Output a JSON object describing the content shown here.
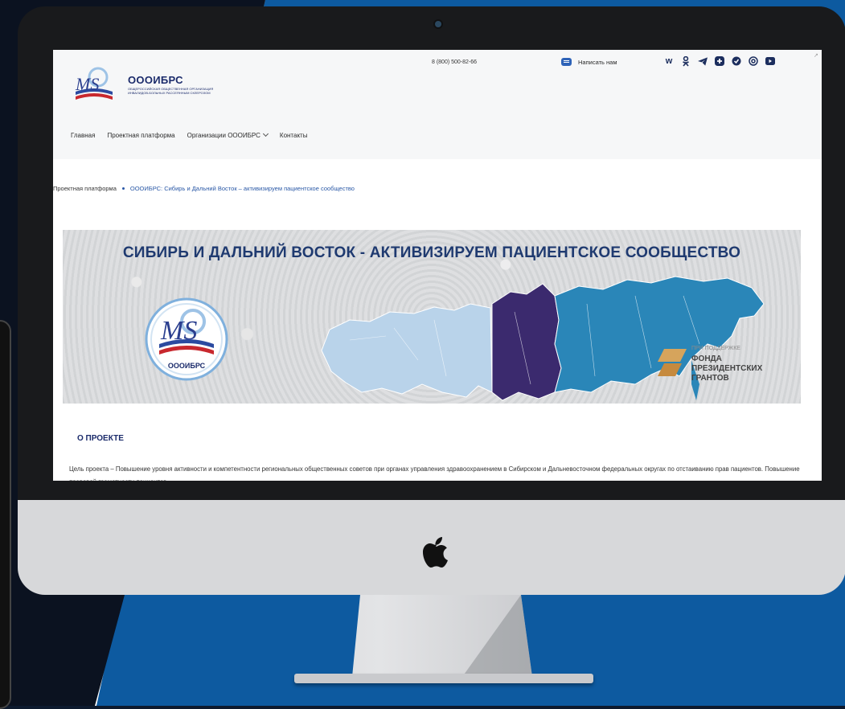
{
  "site": {
    "brand_name": "ОООИБРС",
    "brand_tagline": "Общероссийская общественная организация инвалидов-больных рассеянным склерозом",
    "logo_letters": "MS",
    "phone": "8 (800) 500-82-66",
    "write_us": "Написать нам",
    "social_icons": [
      "vk-icon",
      "odnoklassniki-icon",
      "telegram-icon",
      "plus-icon",
      "shield-icon",
      "at-icon",
      "youtube-icon"
    ]
  },
  "nav": {
    "items": [
      "Главная",
      "Проектная платформа",
      "Организации ОООИБРС",
      "Контакты"
    ]
  },
  "breadcrumb": {
    "parent": "Проектная платформа",
    "current": "ОООИБРС: Сибирь и Дальний Восток – активизируем пациентское сообщество"
  },
  "banner": {
    "title": "СИБИРЬ И ДАЛЬНИЙ ВОСТОК - АКТИВИЗИРУЕМ ПАЦИЕНТСКОЕ СООБЩЕСТВО",
    "logo_caption": "ОООИБРС",
    "support_line1": "ПРИ ПОДДЕРЖКЕ",
    "support_line2": "ФОНДА",
    "support_line3": "ПРЕЗИДЕНТСКИХ",
    "support_line4": "ГРАНТОВ"
  },
  "about": {
    "heading": "О ПРОЕКТЕ",
    "text": "Цель проекта – Повышение уровня активности и компетентности региональных общественных советов при органах управления здравоохранением в Сибирском и Дальневосточном федеральных округах по отстаиванию прав пациентов. Повышение правовой грамотности пациентов."
  },
  "colors": {
    "brand_navy": "#1b2b6b",
    "link_blue": "#2a58a6",
    "background_blue": "#0d5aa0",
    "map_siberia": "#3b2a6e",
    "map_far_east": "#2a86b8",
    "map_west": "#b9d3ea"
  }
}
